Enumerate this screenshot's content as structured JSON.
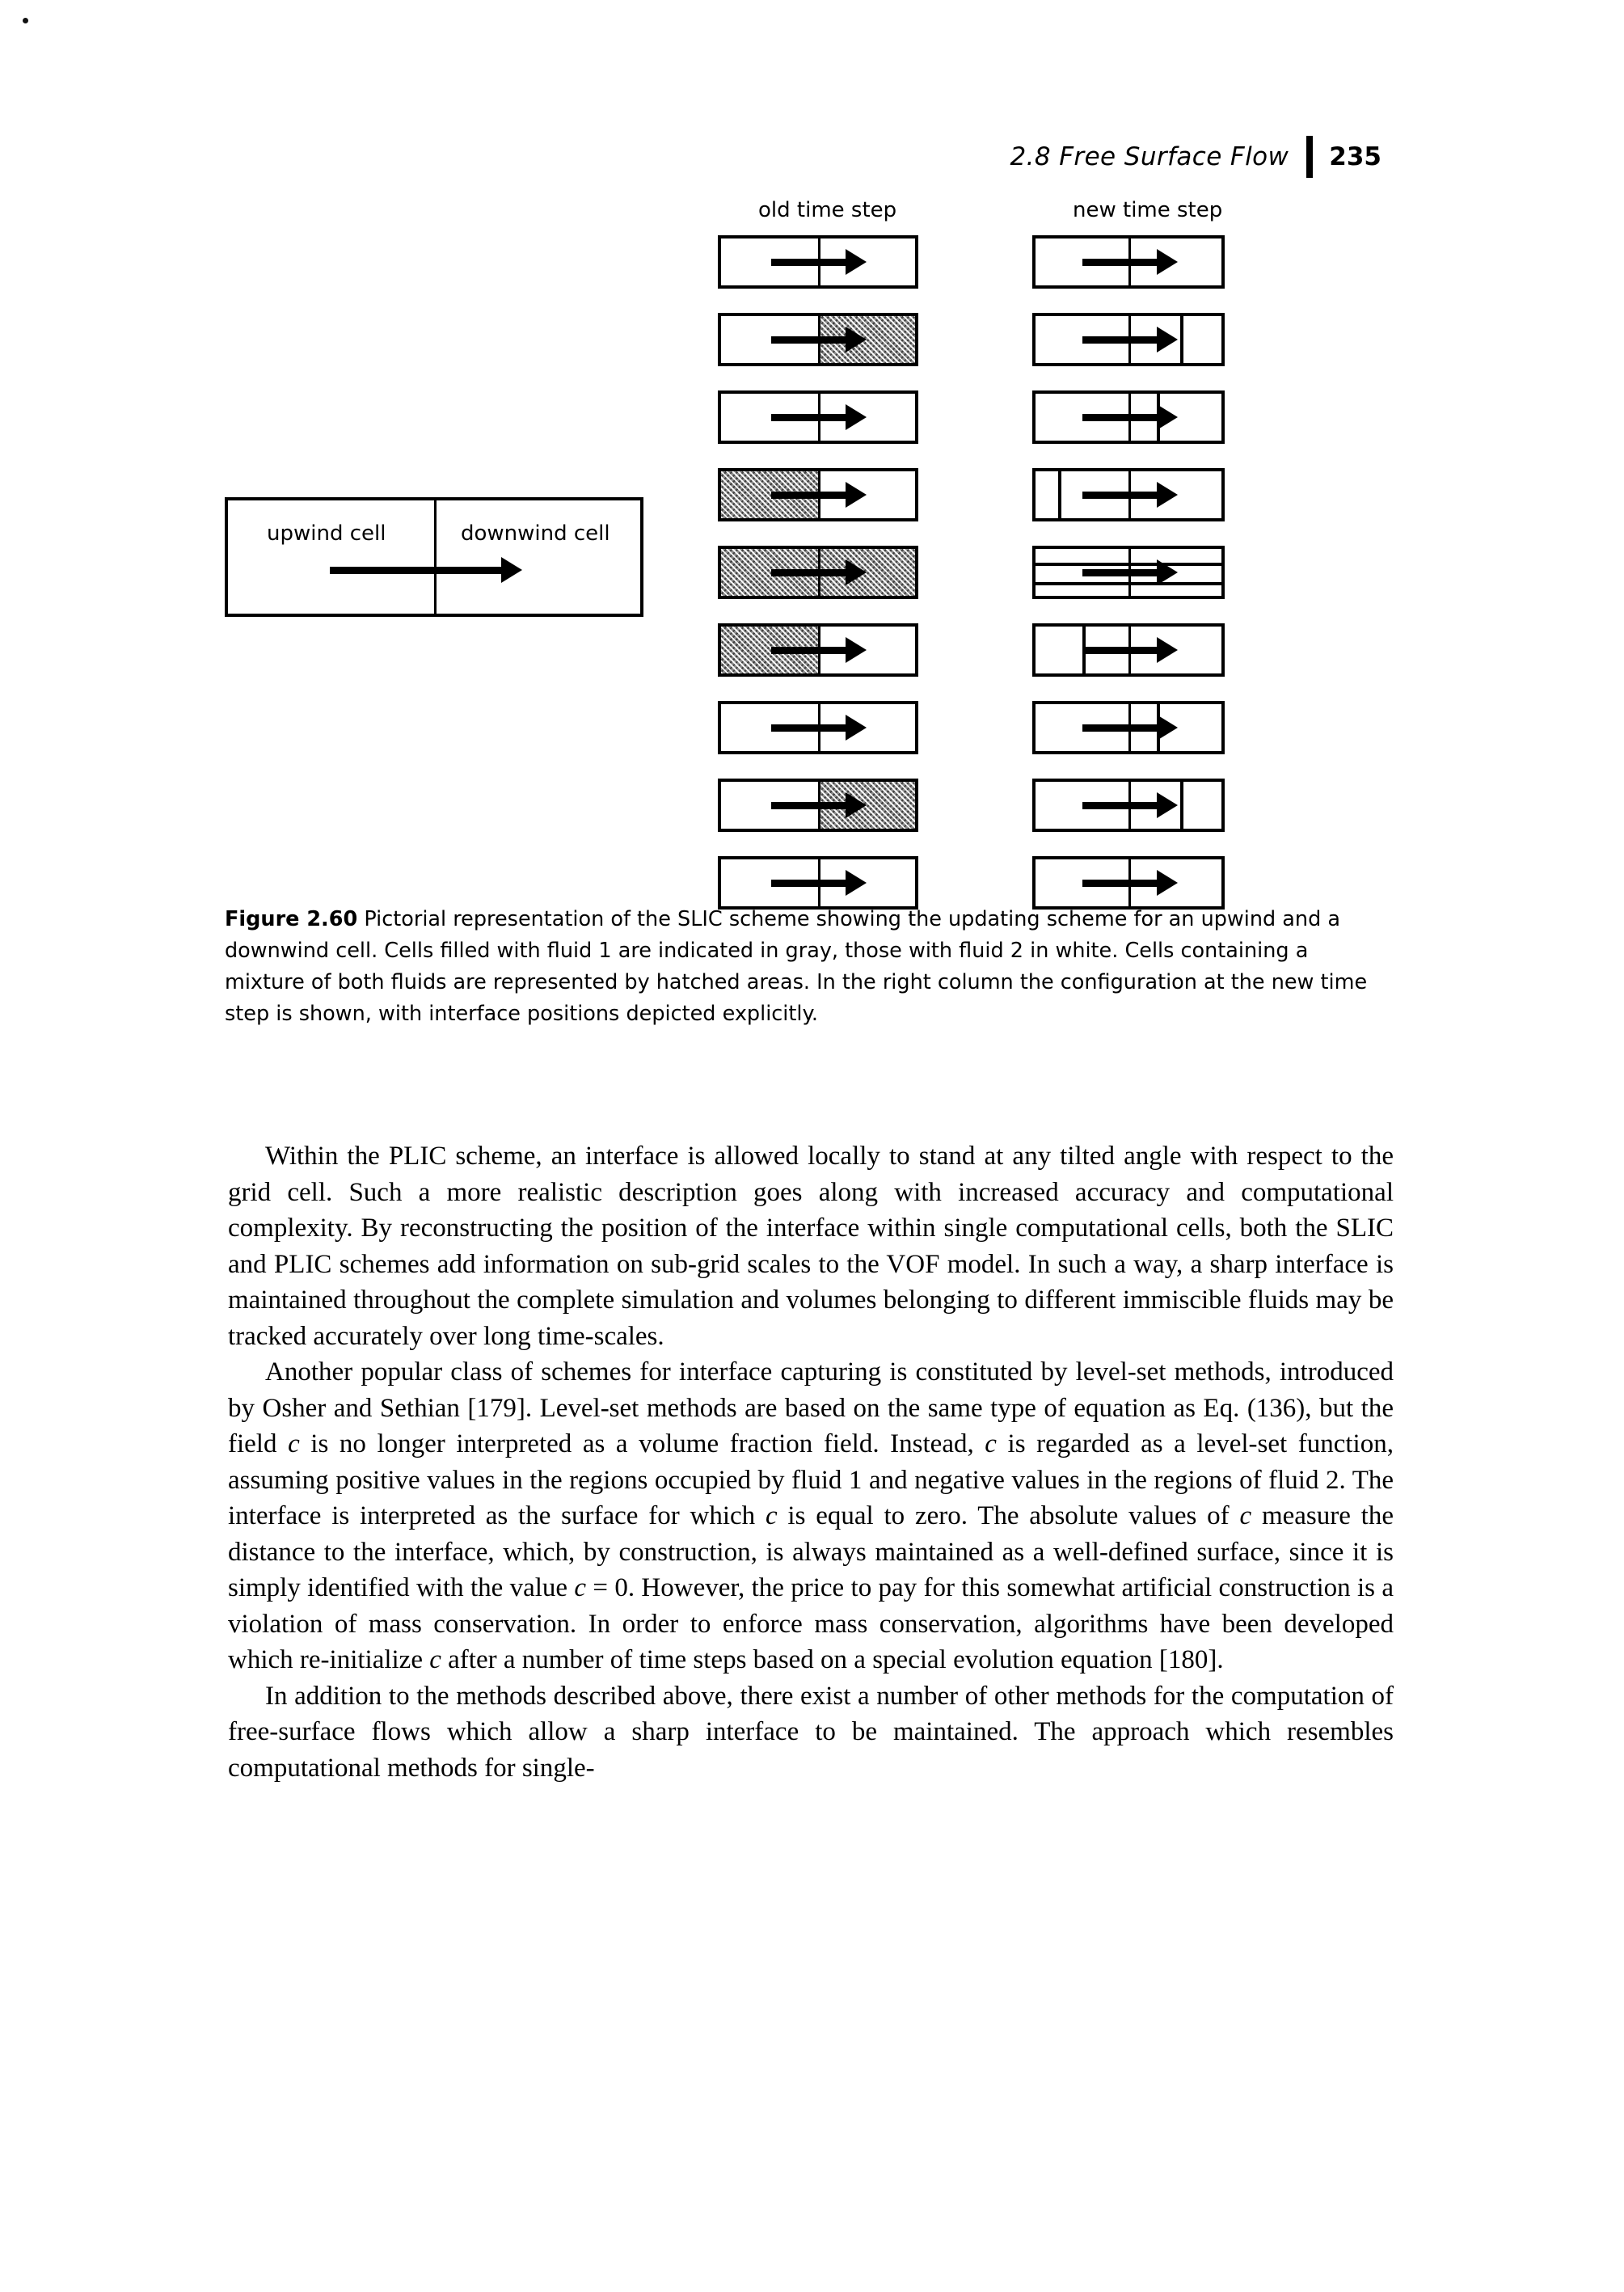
{
  "running_head": {
    "section": "2.8  Free Surface Flow",
    "page_number": "235"
  },
  "figure": {
    "column_headings": {
      "old": "old time step",
      "new": "new time step"
    },
    "legend": {
      "upwind_label": "upwind cell",
      "downwind_label": "downwind cell"
    },
    "rows": [
      {
        "old_upwind": "white",
        "old_downwind": "white",
        "new_interfaces": []
      },
      {
        "old_upwind": "white",
        "old_downwind": "hatched",
        "new_interfaces": [
          78
        ]
      },
      {
        "old_upwind": "white",
        "old_downwind": "white",
        "new_interfaces": [
          65
        ]
      },
      {
        "old_upwind": "hatched",
        "old_downwind": "white",
        "new_interfaces": [
          12
        ]
      },
      {
        "old_upwind": "hatched",
        "old_downwind": "hatched",
        "new_interfaces": []
      },
      {
        "old_upwind": "hatched",
        "old_downwind": "white",
        "new_interfaces": [
          25
        ]
      },
      {
        "old_upwind": "white",
        "old_downwind": "white",
        "new_interfaces": [
          65
        ]
      },
      {
        "old_upwind": "white",
        "old_downwind": "hatched",
        "new_interfaces": [
          78
        ]
      },
      {
        "old_upwind": "white",
        "old_downwind": "white",
        "new_interfaces": []
      }
    ],
    "caption_label": "Figure 2.60",
    "caption_text": "  Pictorial representation of the SLIC scheme showing the updating scheme for an upwind and a downwind cell. Cells filled with fluid 1 are indicated in gray, those with fluid 2 in white. Cells containing a mixture of both fluids are represented by hatched areas. In the right column the configuration at the new time step is shown, with interface positions depicted explicitly."
  },
  "body": {
    "paragraph_1": "Within the PLIC scheme, an interface is allowed locally to stand at any tilted angle with respect to the grid cell. Such a more realistic description goes along with increased accuracy and computational complexity. By reconstructing the position of the interface within single computational cells, both the SLIC and PLIC schemes add information on sub-grid scales to the VOF model. In such a way, a sharp interface is maintained throughout the complete simulation and volumes belonging to different immiscible fluids may be tracked accurately over long time-scales.",
    "paragraph_2_part1": "Another popular class of schemes for interface capturing is constituted by level-set methods, introduced by Osher and Sethian [179]. Level-set methods are based on the same type of equation as Eq. (136), but the field ",
    "paragraph_2_var1": "c",
    "paragraph_2_part2": " is no longer interpreted as a volume fraction field. Instead, ",
    "paragraph_2_var2": "c",
    "paragraph_2_part3": " is regarded as a level-set function, assuming positive values in the regions occupied by fluid 1 and negative values in the regions of fluid 2. The interface is interpreted as the surface for which ",
    "paragraph_2_var3": "c",
    "paragraph_2_part4": " is equal to zero. The absolute values of ",
    "paragraph_2_var4": "c",
    "paragraph_2_part5": " measure the distance to the interface, which, by construction, is always maintained as a well-defined surface, since it is simply identified with the value ",
    "paragraph_2_var5": "c",
    "paragraph_2_part6": " = 0. However, the price to pay for this somewhat artificial construction is a violation of mass conservation. In order to enforce mass conservation, algorithms have been developed which re-initialize ",
    "paragraph_2_var6": "c",
    "paragraph_2_part7": " after a number of time steps based on a special evolution equation [180].",
    "paragraph_3": "In addition to the methods described above, there exist a number of other methods for the computation of free-surface flows which allow a sharp interface to be maintained. The approach which resembles computational methods for single-"
  }
}
